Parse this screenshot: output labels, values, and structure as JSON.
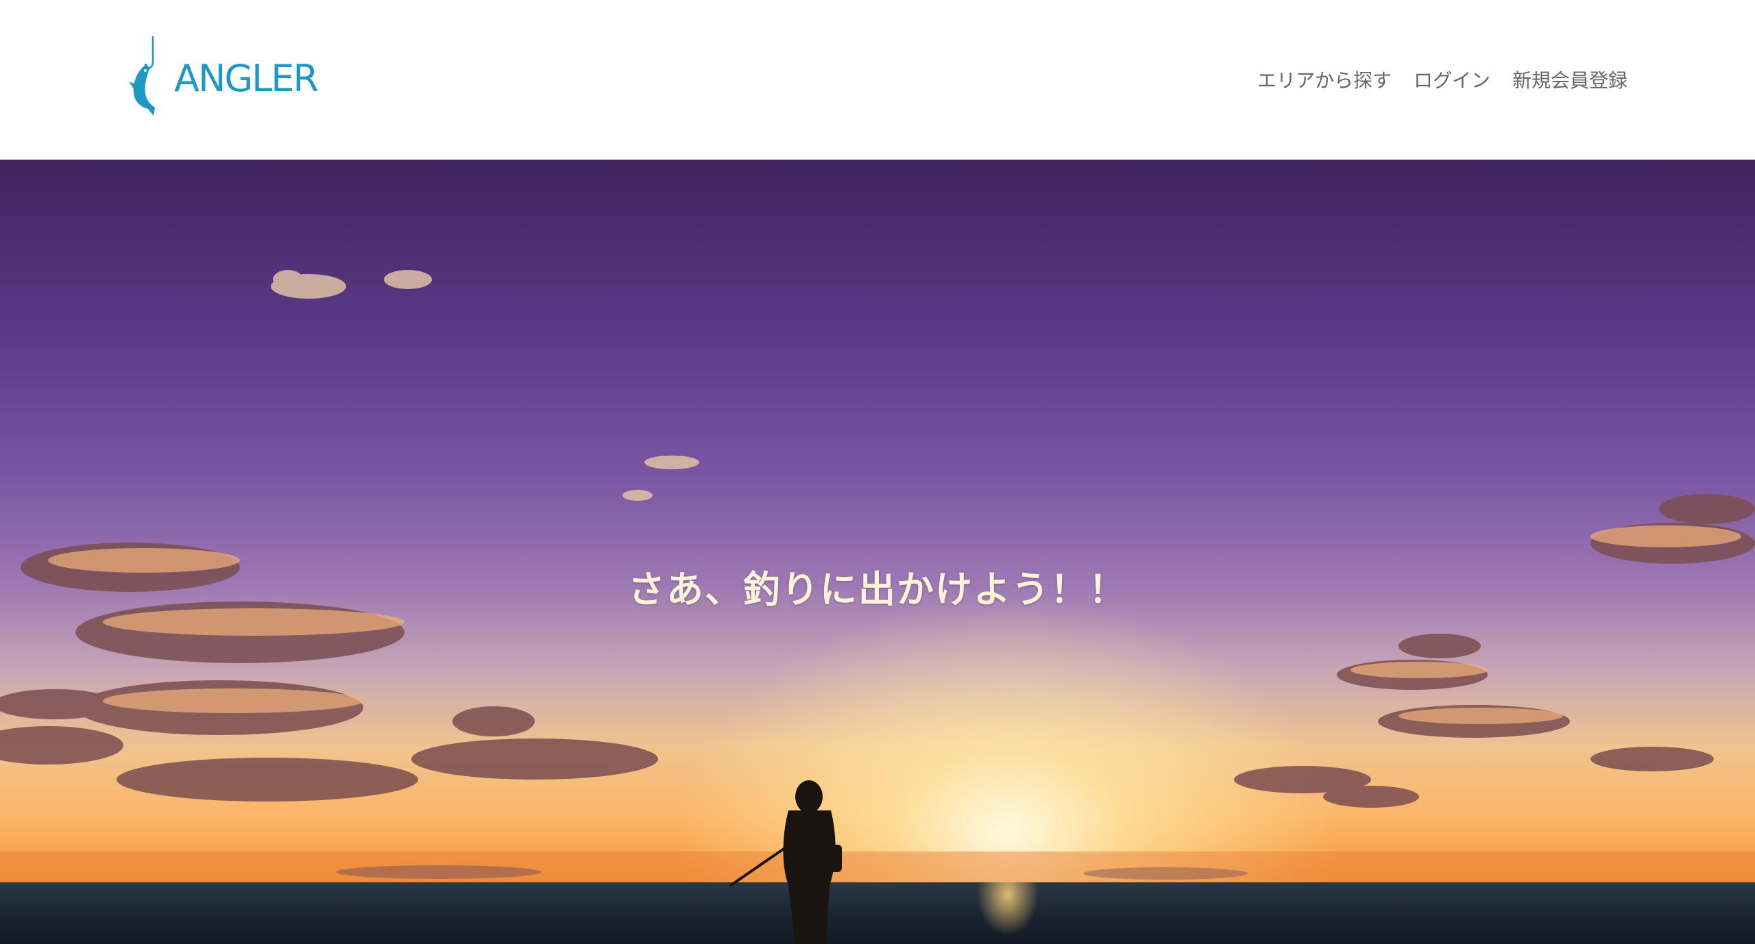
{
  "header": {
    "logo_text": "ANGLER",
    "nav": [
      {
        "label": "エリアから探す"
      },
      {
        "label": "ログイン"
      },
      {
        "label": "新規会員登録"
      }
    ]
  },
  "hero": {
    "title": "さあ、釣りに出かけよう！！"
  },
  "colors": {
    "brand": "#1c97c6",
    "nav_text": "#666666",
    "hero_title": "#fdf3d6"
  },
  "icons": {
    "logo": "fish-hook-icon"
  }
}
